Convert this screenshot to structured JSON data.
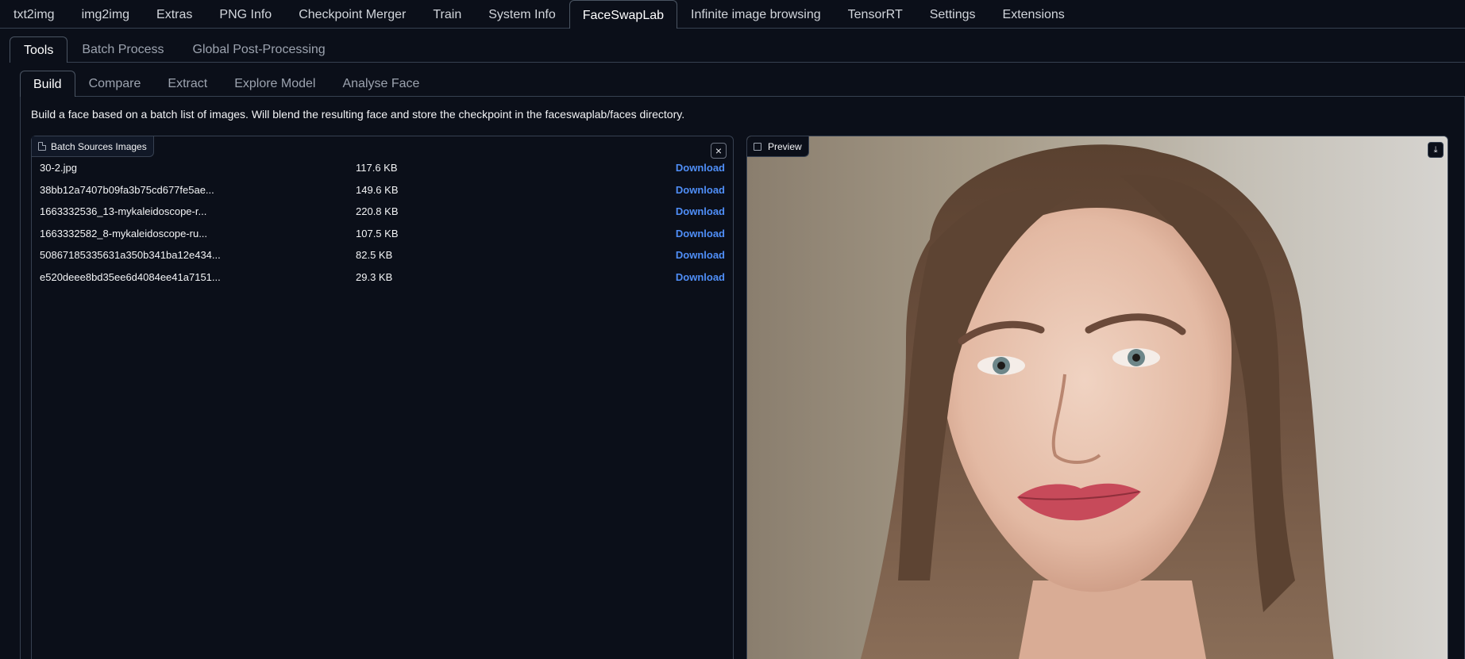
{
  "top_tabs": [
    {
      "label": "txt2img"
    },
    {
      "label": "img2img"
    },
    {
      "label": "Extras"
    },
    {
      "label": "PNG Info"
    },
    {
      "label": "Checkpoint Merger"
    },
    {
      "label": "Train"
    },
    {
      "label": "System Info"
    },
    {
      "label": "FaceSwapLab",
      "active": true
    },
    {
      "label": "Infinite image browsing"
    },
    {
      "label": "TensorRT"
    },
    {
      "label": "Settings"
    },
    {
      "label": "Extensions"
    }
  ],
  "sub_tabs": [
    {
      "label": "Tools",
      "active": true
    },
    {
      "label": "Batch Process"
    },
    {
      "label": "Global Post-Processing"
    }
  ],
  "tool_tabs": [
    {
      "label": "Build",
      "active": true
    },
    {
      "label": "Compare"
    },
    {
      "label": "Extract"
    },
    {
      "label": "Explore Model"
    },
    {
      "label": "Analyse Face"
    }
  ],
  "build": {
    "description": "Build a face based on a batch list of images. Will blend the resulting face and store the checkpoint in the faceswaplab/faces directory."
  },
  "batch_sources": {
    "label": "Batch Sources Images",
    "close_icon": "×",
    "files": [
      {
        "name": "30-2.jpg",
        "size": "117.6 KB",
        "action": "Download"
      },
      {
        "name": "38bb12a7407b09fa3b75cd677fe5ae...",
        "size": "149.6 KB",
        "action": "Download"
      },
      {
        "name": "1663332536_13-mykaleidoscope-r...",
        "size": "220.8 KB",
        "action": "Download"
      },
      {
        "name": "1663332582_8-mykaleidoscope-ru...",
        "size": "107.5 KB",
        "action": "Download"
      },
      {
        "name": "50867185335631a350b341ba12e434...",
        "size": "82.5 KB",
        "action": "Download"
      },
      {
        "name": "e520deee8bd35ee6d4084ee41a7151...",
        "size": "29.3 KB",
        "action": "Download"
      }
    ]
  },
  "preview": {
    "label": "Preview",
    "download_icon": "⤓"
  },
  "colors": {
    "background": "#0b0f19",
    "border": "#374151",
    "link": "#4f8ef7"
  }
}
